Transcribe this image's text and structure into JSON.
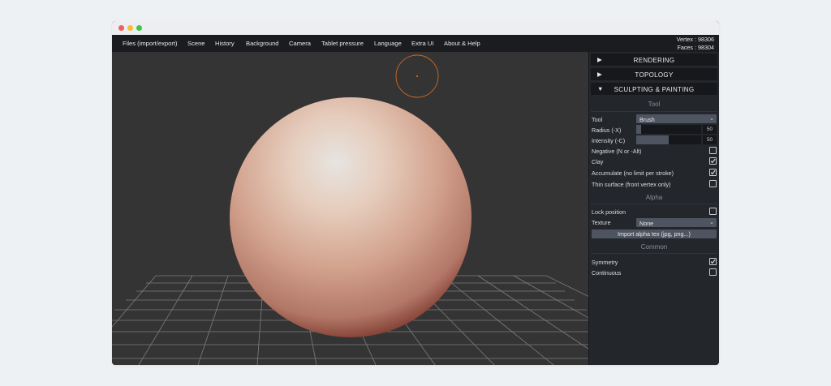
{
  "menu": {
    "items": [
      "Files (import/export)",
      "Scene",
      "History",
      "Background",
      "Camera",
      "Tablet pressure",
      "Language",
      "Extra UI",
      "About & Help"
    ]
  },
  "stats": {
    "vertex": "Vertex : 98306",
    "faces": "Faces : 98304"
  },
  "panel": {
    "folders": {
      "rendering": "RENDERING",
      "topology": "TOPOLOGY",
      "sculpting": "SCULPTING & PAINTING"
    },
    "tool_section": {
      "title": "Tool",
      "tool_label": "Tool",
      "tool_value": "Brush",
      "radius_label": "Radius (-X)",
      "radius_value": "50",
      "radius_fraction": 0.08,
      "intensity_label": "Intensity (-C)",
      "intensity_value": "50",
      "intensity_fraction": 0.5,
      "negative_label": "Negative (N or -Alt)",
      "negative_checked": false,
      "clay_label": "Clay",
      "clay_checked": true,
      "accumulate_label": "Accumulate (no limit per stroke)",
      "accumulate_checked": true,
      "thin_label": "Thin surface (front vertex only)",
      "thin_checked": false
    },
    "alpha_section": {
      "title": "Alpha",
      "lock_label": "Lock position",
      "lock_checked": false,
      "texture_label": "Texture",
      "texture_value": "None",
      "import_button": "Import alpha tex (jpg, png...)"
    },
    "common_section": {
      "title": "Common",
      "symmetry_label": "Symmetry",
      "symmetry_checked": true,
      "continuous_label": "Continuous",
      "continuous_checked": false
    }
  },
  "icons": {
    "collapsed": "triangle-right-icon",
    "expanded": "triangle-down-icon",
    "dropdown": "chevron-down-icon",
    "check": "checkmark-icon"
  },
  "colors": {
    "accent_cursor": "#d2691e",
    "sphere_highlight": "#e8e4e0",
    "sphere_shadow": "#5a1a14"
  }
}
